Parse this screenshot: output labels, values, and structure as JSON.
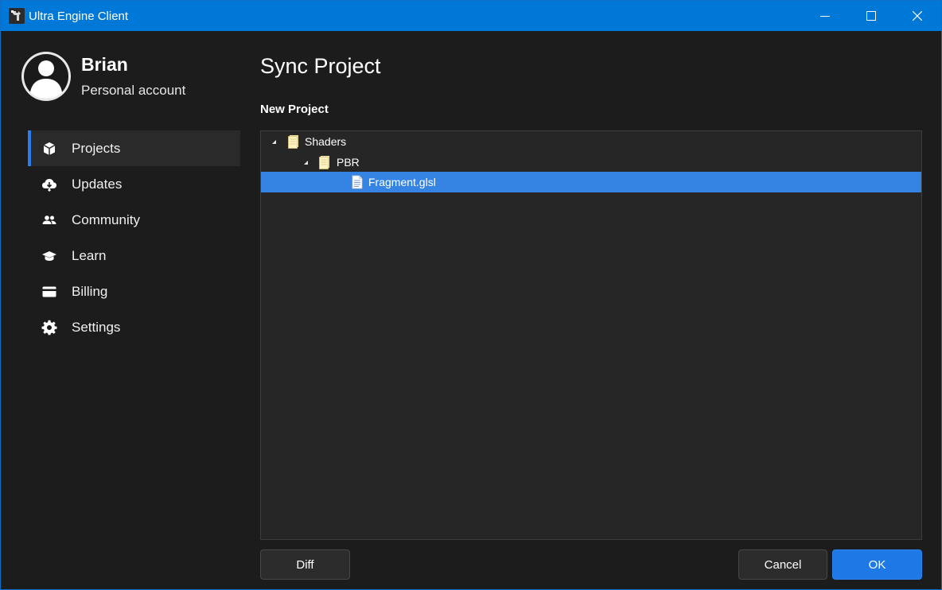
{
  "window": {
    "title": "Ultra Engine Client",
    "controls": [
      "minimize-icon",
      "maximize-icon",
      "close-icon"
    ],
    "titlebar_color": "#0078d7"
  },
  "user": {
    "name": "Brian",
    "account_type": "Personal account"
  },
  "sidebar": {
    "items": [
      {
        "label": "Projects",
        "icon": "cube-icon",
        "active": true
      },
      {
        "label": "Updates",
        "icon": "cloud-download-icon",
        "active": false
      },
      {
        "label": "Community",
        "icon": "people-icon",
        "active": false
      },
      {
        "label": "Learn",
        "icon": "graduation-cap-icon",
        "active": false
      },
      {
        "label": "Billing",
        "icon": "credit-card-icon",
        "active": false
      },
      {
        "label": "Settings",
        "icon": "gear-icon",
        "active": false
      }
    ],
    "accent_color": "#2b7de9"
  },
  "main": {
    "title": "Sync Project",
    "section_label": "New Project",
    "tree": [
      {
        "label": "Shaders",
        "type": "folder",
        "expanded": true,
        "depth": 0,
        "selected": false
      },
      {
        "label": "PBR",
        "type": "folder",
        "expanded": true,
        "depth": 1,
        "selected": false
      },
      {
        "label": "Fragment.glsl",
        "type": "file",
        "depth": 2,
        "selected": true
      }
    ],
    "selection_color": "#3584e4"
  },
  "buttons": {
    "diff": "Diff",
    "cancel": "Cancel",
    "ok": "OK"
  }
}
